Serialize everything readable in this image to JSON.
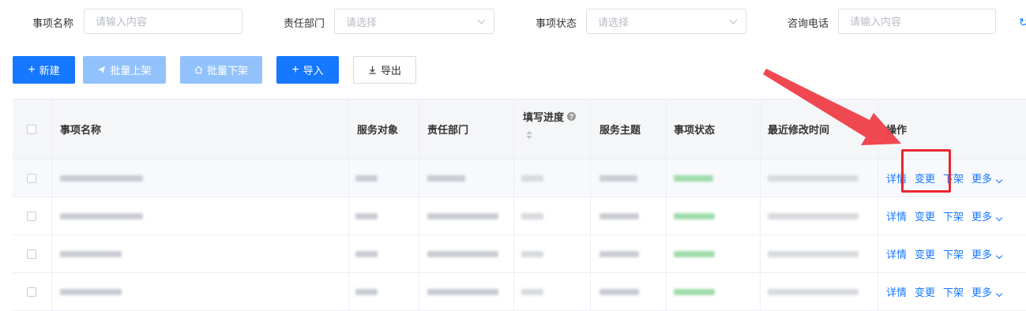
{
  "filters": [
    {
      "label": "事项名称",
      "type": "input",
      "placeholder": "请输入内容"
    },
    {
      "label": "责任部门",
      "type": "select",
      "placeholder": "请选择"
    },
    {
      "label": "事项状态",
      "type": "select",
      "placeholder": "请选择"
    },
    {
      "label": "咨询电话",
      "type": "input",
      "placeholder": "请输入内容"
    }
  ],
  "refresh_icon": "refresh-icon",
  "toolbar": {
    "new": "新建",
    "batch_up": "批量上架",
    "batch_down": "批量下架",
    "import": "导入",
    "export": "导出"
  },
  "table": {
    "columns": [
      "事项名称",
      "服务对象",
      "责任部门",
      "填写进度",
      "服务主题",
      "事项状态",
      "最近修改时间",
      "操作"
    ],
    "row_actions": {
      "detail": "详情",
      "change": "变更",
      "offline": "下架",
      "more": "更多"
    }
  },
  "colors": {
    "primary": "#1677ff",
    "primary_disabled": "#92c2fb",
    "annotation": "#e8272f"
  }
}
